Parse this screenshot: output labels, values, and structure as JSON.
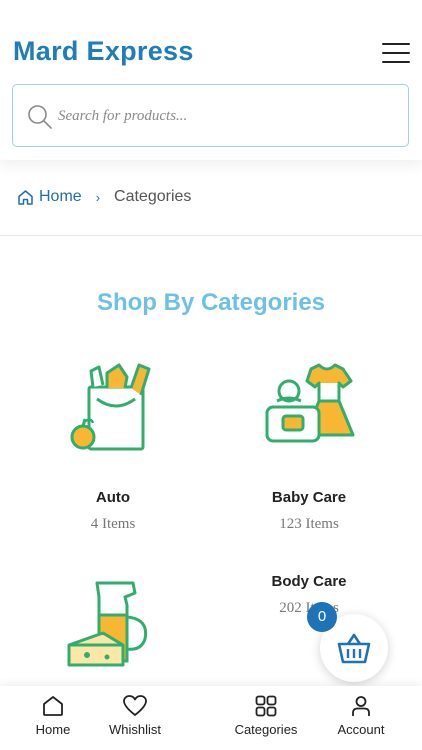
{
  "header": {
    "brand": "Mard Express",
    "menu_icon": "hamburger-menu-icon"
  },
  "search": {
    "placeholder": "Search for products...",
    "value": "",
    "icon": "search-icon"
  },
  "breadcrumb": {
    "home_label": "Home",
    "separator": "›",
    "current": "Categories"
  },
  "section": {
    "title": "Shop By Categories"
  },
  "categories": [
    {
      "name": "Auto",
      "count": "4 Items",
      "icon": "grocery-bag-icon"
    },
    {
      "name": "Baby Care",
      "count": "123 Items",
      "icon": "baby-clothes-icon"
    },
    {
      "name": "",
      "count": "",
      "icon": "juice-cheese-icon"
    },
    {
      "name": "Body Care",
      "count": "202 Items",
      "icon": "body-care-icon"
    }
  ],
  "cart": {
    "count": "0",
    "icon": "basket-icon"
  },
  "bottom_nav": {
    "items": [
      {
        "label": "Home",
        "icon": "home-icon"
      },
      {
        "label": "Whishlist",
        "icon": "heart-icon"
      },
      {
        "label": "Categories",
        "icon": "grid-icon"
      },
      {
        "label": "Account",
        "icon": "user-icon"
      }
    ]
  },
  "colors": {
    "brand": "#1f7db7",
    "title": "#6ec1e4",
    "icon_green": "#2fae6e",
    "icon_orange": "#f7b733",
    "badge": "#1e72b8"
  }
}
